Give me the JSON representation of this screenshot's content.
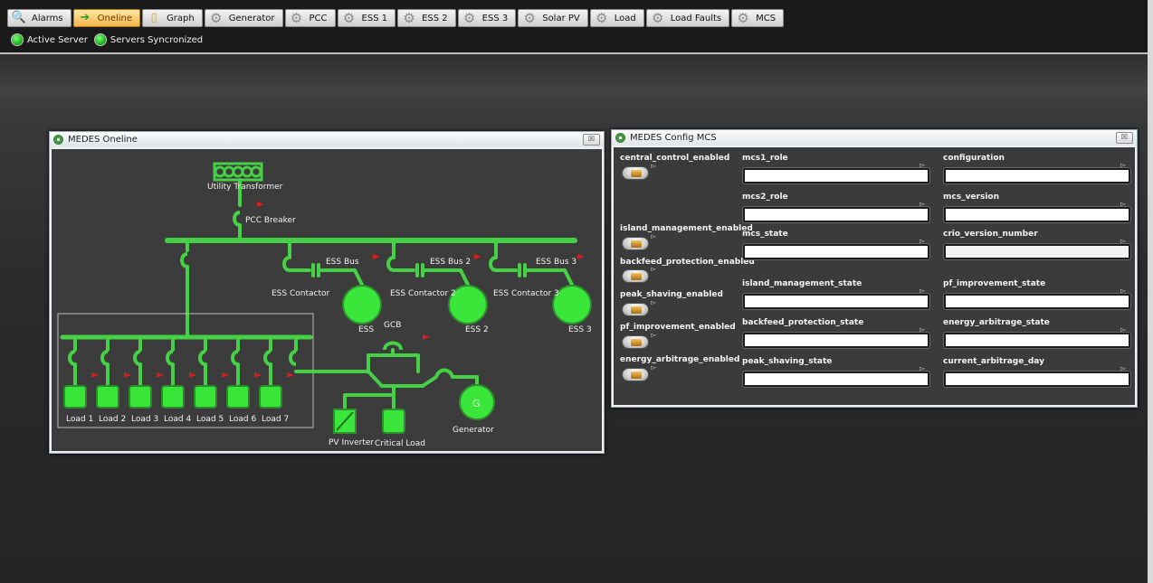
{
  "tabs": [
    {
      "label": "Alarms",
      "icon": "magnifier-icon",
      "active": false
    },
    {
      "label": "Oneline",
      "icon": "green-arrow-icon",
      "active": true
    },
    {
      "label": "Graph",
      "icon": "document-icon",
      "active": false
    },
    {
      "label": "Generator",
      "icon": "gear-icon",
      "active": false
    },
    {
      "label": "PCC",
      "icon": "gear-icon",
      "active": false
    },
    {
      "label": "ESS 1",
      "icon": "gear-icon",
      "active": false
    },
    {
      "label": "ESS 2",
      "icon": "gear-icon",
      "active": false
    },
    {
      "label": "ESS 3",
      "icon": "gear-icon",
      "active": false
    },
    {
      "label": "Solar PV",
      "icon": "gear-icon",
      "active": false
    },
    {
      "label": "Load",
      "icon": "gear-icon",
      "active": false
    },
    {
      "label": "Load Faults",
      "icon": "gear-icon",
      "active": false
    },
    {
      "label": "MCS",
      "icon": "gear-icon",
      "active": false
    }
  ],
  "status": {
    "active_server": "Active Server",
    "servers_synced": "Servers Syncronized",
    "indicator_color": "#2fd62f"
  },
  "oneline": {
    "title": "MEDES Oneline",
    "close": "☒",
    "labels": {
      "utility_transformer": "Utility Transformer",
      "pcc_breaker": "PCC Breaker",
      "ess_bus_1": "ESS Bus",
      "ess_bus_2": "ESS Bus 2",
      "ess_bus_3": "ESS Bus 3",
      "ess_contactor_1": "ESS Contactor",
      "ess_contactor_2": "ESS Contactor 2",
      "ess_contactor_3": "ESS Contactor 3",
      "ess_1": "ESS",
      "ess_2": "ESS 2",
      "ess_3": "ESS 3",
      "gcb": "GCB",
      "generator": "Generator",
      "generator_symbol": "G",
      "pv_inverter": "PV Inverter",
      "critical_load": "Critical Load"
    },
    "loads": [
      "Load 1",
      "Load 2",
      "Load 3",
      "Load 4",
      "Load 5",
      "Load 6",
      "Load 7"
    ],
    "colors": {
      "energized": "#45d045",
      "bright": "#39e639",
      "flag": "#d02020"
    }
  },
  "config": {
    "title": "MEDES Config MCS",
    "close": "☒",
    "toggles": [
      "central_control_enabled",
      "island_management_enabled",
      "backfeed_protection_enabled",
      "peak_shaving_enabled",
      "pf_improvement_enabled",
      "energy_arbitrage_enabled"
    ],
    "fields": {
      "mcs1_role": {
        "label": "mcs1_role",
        "value": ""
      },
      "mcs2_role": {
        "label": "mcs2_role",
        "value": ""
      },
      "mcs_state": {
        "label": "mcs_state",
        "value": ""
      },
      "island_management_state": {
        "label": "island_management_state",
        "value": ""
      },
      "backfeed_protection_state": {
        "label": "backfeed_protection_state",
        "value": ""
      },
      "peak_shaving_state": {
        "label": "peak_shaving_state",
        "value": ""
      },
      "configuration": {
        "label": "configuration",
        "value": ""
      },
      "mcs_version": {
        "label": "mcs_version",
        "value": ""
      },
      "crio_version_number": {
        "label": "crio_version_number",
        "value": ""
      },
      "pf_improvement_state": {
        "label": "pf_improvement_state",
        "value": ""
      },
      "energy_arbitrage_state": {
        "label": "energy_arbitrage_state",
        "value": ""
      },
      "current_arbitrage_day": {
        "label": "current_arbitrage_day",
        "value": ""
      }
    },
    "flag_glyph": "▻"
  }
}
